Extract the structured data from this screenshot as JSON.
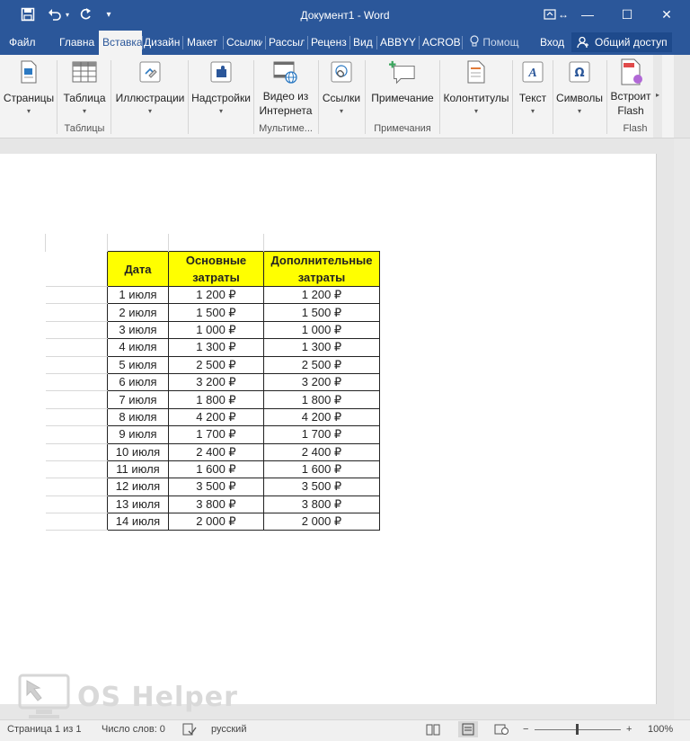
{
  "window": {
    "title": "Документ1 - Word",
    "qat": {
      "save_icon": "save-icon",
      "undo_icon": "undo-icon",
      "redo_icon": "redo-icon",
      "customize_icon": "customize-qat-icon"
    },
    "controls": {
      "ribbon_display_icon": "ribbon-display-options-icon",
      "minimize": "—",
      "maximize": "☐",
      "close": "✕"
    }
  },
  "tabs": [
    {
      "label": "Файл"
    },
    {
      "label": "Главна"
    },
    {
      "label": "Вставка",
      "active": true
    },
    {
      "label": "Дизайн"
    },
    {
      "label": "Макет"
    },
    {
      "label": "Ссылки"
    },
    {
      "label": "Рассыл"
    },
    {
      "label": "Реценз"
    },
    {
      "label": "Вид"
    },
    {
      "label": "ABBYY"
    },
    {
      "label": "ACROB"
    }
  ],
  "tell_me": {
    "placeholder": "Помощ"
  },
  "signin": "Вход",
  "share": "Общий доступ",
  "ribbon": {
    "pages": {
      "label": "Страницы"
    },
    "table": {
      "label": "Таблица"
    },
    "illustrations": {
      "label": "Иллюстрации"
    },
    "addins": {
      "label": "Надстройки"
    },
    "online_video": {
      "label1": "Видео из",
      "label2": "Интернета"
    },
    "links": {
      "label": "Ссылки"
    },
    "comment": {
      "label": "Примечание"
    },
    "header_footer": {
      "label": "Колонтитулы"
    },
    "text": {
      "label": "Текст"
    },
    "symbols": {
      "label": "Символы"
    },
    "flash": {
      "label1": "Встроит",
      "label2": "Flash"
    },
    "groups": {
      "tables": "Таблицы",
      "media": "Мультиме...",
      "comments": "Примечания",
      "flash": "Flash"
    }
  },
  "table": {
    "headers": [
      "Дата",
      "Основные затраты",
      "Дополнительные затраты"
    ],
    "rows": [
      [
        "1 июля",
        "1 200 ₽",
        "1 200 ₽"
      ],
      [
        "2 июля",
        "1 500 ₽",
        "1 500 ₽"
      ],
      [
        "3 июля",
        "1 000 ₽",
        "1 000 ₽"
      ],
      [
        "4 июля",
        "1 300 ₽",
        "1 300 ₽"
      ],
      [
        "5 июля",
        "2 500 ₽",
        "2 500 ₽"
      ],
      [
        "6 июля",
        "3 200 ₽",
        "3 200 ₽"
      ],
      [
        "7 июля",
        "1 800 ₽",
        "1 800 ₽"
      ],
      [
        "8 июля",
        "4 200 ₽",
        "4 200 ₽"
      ],
      [
        "9 июля",
        "1 700 ₽",
        "1 700 ₽"
      ],
      [
        "10 июля",
        "2 400 ₽",
        "2 400 ₽"
      ],
      [
        "11 июля",
        "1 600 ₽",
        "1 600 ₽"
      ],
      [
        "12 июля",
        "3 500 ₽",
        "3 500 ₽"
      ],
      [
        "13 июля",
        "3 800 ₽",
        "3 800 ₽"
      ],
      [
        "14 июля",
        "2 000 ₽",
        "2 000 ₽"
      ]
    ]
  },
  "watermark": {
    "text": "OS Helper"
  },
  "status": {
    "page": "Страница 1 из 1",
    "words": "Число слов: 0",
    "language": "русский",
    "zoom": "100%",
    "zoom_minus": "−",
    "zoom_plus": "+"
  },
  "colors": {
    "brand": "#2b579a",
    "header_fill": "#ffff00"
  }
}
